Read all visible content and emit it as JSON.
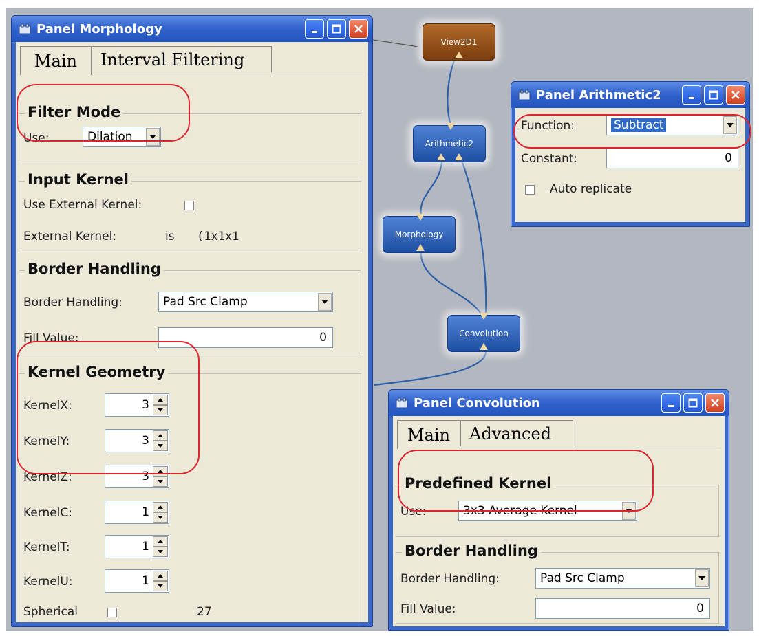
{
  "morphology": {
    "title": "Panel Morphology",
    "tabs": [
      "Main",
      "Interval Filtering"
    ],
    "filter_mode": {
      "title": "Filter Mode",
      "use_label": "Use:",
      "use_value": "Dilation"
    },
    "input_kernel": {
      "title": "Input Kernel",
      "use_external_label": "Use External Kernel:",
      "external_label": "External Kernel:",
      "external_value": "is",
      "external_dims": "(1x1x1"
    },
    "border_handling": {
      "title": "Border Handling",
      "label": "Border Handling:",
      "value": "Pad Src Clamp",
      "fill_label": "Fill Value:",
      "fill_value": "0"
    },
    "kernel_geometry": {
      "title": "Kernel Geometry",
      "rows": [
        {
          "label": "KernelX:",
          "value": "3"
        },
        {
          "label": "KernelY:",
          "value": "3"
        },
        {
          "label": "KernelZ:",
          "value": "3"
        },
        {
          "label": "KernelC:",
          "value": "1"
        },
        {
          "label": "KernelT:",
          "value": "1"
        },
        {
          "label": "KernelU:",
          "value": "1"
        }
      ],
      "spherical_label": "Spherical",
      "spherical_count": "27"
    }
  },
  "arithmetic": {
    "title": "Panel Arithmetic2",
    "function_label": "Function:",
    "function_value": "Subtract",
    "constant_label": "Constant:",
    "constant_value": "0",
    "auto_replicate_label": "Auto replicate"
  },
  "convolution": {
    "title": "Panel Convolution",
    "tabs": [
      "Main",
      "Advanced"
    ],
    "predefined": {
      "title": "Predefined Kernel",
      "use_label": "Use:",
      "use_value": "3x3 Average Kernel"
    },
    "border_handling": {
      "title": "Border Handling",
      "label": "Border Handling:",
      "value": "Pad Src Clamp",
      "fill_label": "Fill Value:",
      "fill_value": "0"
    }
  },
  "network": {
    "nodes": [
      "View2D1",
      "Arithmetic2",
      "Morphology",
      "Convolution"
    ]
  },
  "colors": {
    "canvas": "#b3b7bf",
    "title_blue": "#2e5fc9",
    "panel_bg": "#ece9d8",
    "highlight_red": "#e0242e",
    "node_blue": "#2f62b8",
    "node_brown": "#8f4f18"
  }
}
